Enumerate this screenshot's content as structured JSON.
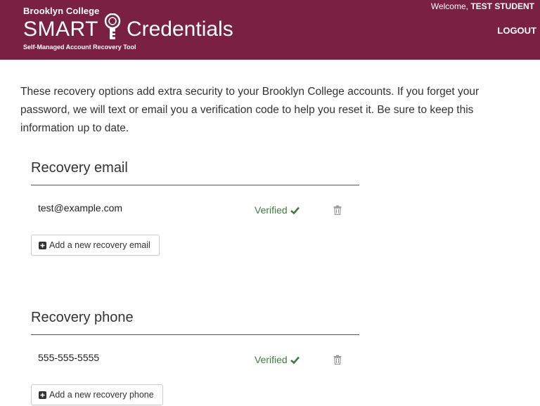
{
  "header": {
    "brand_top": "Brooklyn College",
    "brand_smart": "SMART",
    "brand_credentials": "Credentials",
    "brand_subtitle": "Self-Managed Account Recovery Tool",
    "welcome_prefix": "Welcome,",
    "user_name": "TEST STUDENT",
    "logout": "LOGOUT",
    "bg_color": "#7a2142"
  },
  "intro": "These recovery options add extra security to your Brooklyn College accounts. If you forget your password, we will text or email you a verification code to help you reset it. Be sure to keep this information up to date.",
  "email_section": {
    "title": "Recovery email",
    "value": "test@example.com",
    "status": "Verified",
    "add_label": "Add a new recovery email"
  },
  "phone_section": {
    "title": "Recovery phone",
    "value": "555-555-5555",
    "status": "Verified",
    "add_label": "Add a new recovery phone"
  },
  "colors": {
    "verified": "#3c7d3c",
    "rule": "#555555"
  }
}
